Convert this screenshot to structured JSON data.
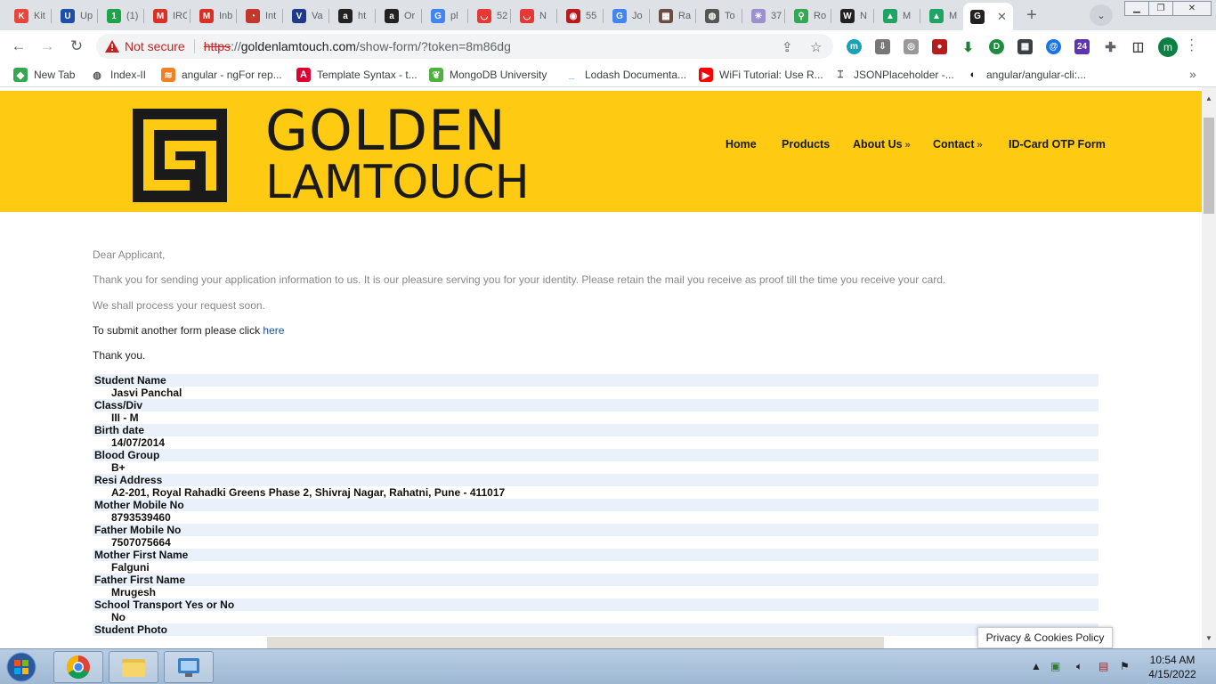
{
  "browser": {
    "tabs": [
      {
        "label": "Kit",
        "fav": "K",
        "color": "#e8453c"
      },
      {
        "label": "Up",
        "fav": "U",
        "color": "#1f4ea8"
      },
      {
        "label": "(1)",
        "fav": "1",
        "color": "#1ea446"
      },
      {
        "label": "IRC",
        "fav": "M",
        "color": "#d93025"
      },
      {
        "label": "Inb",
        "fav": "M",
        "color": "#d93025"
      },
      {
        "label": "Int",
        "fav": "◔",
        "color": "#c0392b"
      },
      {
        "label": "Va",
        "fav": "V",
        "color": "#1e3a8a"
      },
      {
        "label": "ht",
        "fav": "a",
        "color": "#222222"
      },
      {
        "label": "Or",
        "fav": "a",
        "color": "#222222"
      },
      {
        "label": "pl",
        "fav": "G",
        "color": "#4285f4"
      },
      {
        "label": "52",
        "fav": "◡",
        "color": "#e53935"
      },
      {
        "label": "N",
        "fav": "◡",
        "color": "#e53935"
      },
      {
        "label": "55",
        "fav": "◉",
        "color": "#b71c1c"
      },
      {
        "label": "Jo",
        "fav": "G",
        "color": "#4285f4"
      },
      {
        "label": "Ra",
        "fav": "▦",
        "color": "#6d4c41"
      },
      {
        "label": "To",
        "fav": "◍",
        "color": "#555555"
      },
      {
        "label": "37",
        "fav": "✳",
        "color": "#9c8fd0"
      },
      {
        "label": "Ro",
        "fav": "⚲",
        "color": "#34a853"
      },
      {
        "label": "N",
        "fav": "W",
        "color": "#222222"
      },
      {
        "label": "M",
        "fav": "▲",
        "color": "#1fa463"
      },
      {
        "label": "M",
        "fav": "▲",
        "color": "#1fa463"
      }
    ],
    "active_tab_close": "✕",
    "new_tab": "+",
    "omnibox": {
      "not_secure": "Not secure",
      "scheme": "https",
      "host_sep": "://",
      "host": "goldenlamtouch.com",
      "path": "/show-form/?token=8m86dg"
    },
    "profile_initial": "m",
    "bookmarks": [
      {
        "label": "New Tab",
        "icon": "leaf-icon"
      },
      {
        "label": "Index-II",
        "icon": "globe-icon"
      },
      {
        "label": "angular - ngFor rep...",
        "icon": "stackoverflow-icon"
      },
      {
        "label": "Template Syntax - t...",
        "icon": "angular-icon"
      },
      {
        "label": "MongoDB University",
        "icon": "mongodb-icon"
      },
      {
        "label": "Lodash Documenta...",
        "icon": "lodash-icon"
      },
      {
        "label": "WiFi Tutorial: Use R...",
        "icon": "youtube-icon"
      },
      {
        "label": "JSONPlaceholder -...",
        "icon": "jsonplaceholder-icon"
      },
      {
        "label": "angular/angular-cli:...",
        "icon": "github-icon"
      }
    ]
  },
  "site": {
    "logo_line1": "GOLDEN",
    "logo_line2": "LAMTOUCH",
    "nav": [
      {
        "label": "Home",
        "arrow": ""
      },
      {
        "label": "Products",
        "arrow": ""
      },
      {
        "label": "About Us",
        "arrow": "»"
      },
      {
        "label": "Contact",
        "arrow": "»"
      },
      {
        "label": "ID-Card OTP Form",
        "arrow": ""
      }
    ],
    "colors": {
      "brand_yellow": "#fecb12",
      "row_highlight": "#eaf1fb",
      "link": "#1a55a0"
    }
  },
  "message": {
    "greeting": "Dear Applicant,",
    "thanks": "Thank you for sending your application information to us. It is our pleasure serving you for your identity. Please retain the mail you receive as proof till the time you receive your card.",
    "process": "We shall process your request soon.",
    "another_prefix": "To submit another form please click ",
    "another_link": "here",
    "thank_you": "Thank you."
  },
  "record": [
    {
      "label": "Student Name",
      "value": "Jasvi Panchal"
    },
    {
      "label": "Class/Div",
      "value": "III - M"
    },
    {
      "label": "Birth date",
      "value": "14/07/2014"
    },
    {
      "label": "Blood Group",
      "value": "B+"
    },
    {
      "label": "Resi Address",
      "value": "A2-201, Royal Rahadki Greens Phase 2, Shivraj Nagar, Rahatni, Pune - 411017"
    },
    {
      "label": "Mother Mobile No",
      "value": "8793539460"
    },
    {
      "label": "Father Mobile No",
      "value": "7507075664"
    },
    {
      "label": "Mother First Name",
      "value": "Falguni"
    },
    {
      "label": "Father First Name",
      "value": "Mrugesh"
    },
    {
      "label": "School Transport Yes or No",
      "value": "No"
    },
    {
      "label": "Student Photo",
      "value": ""
    }
  ],
  "cookie_banner": "Privacy & Cookies Policy",
  "taskbar": {
    "time": "10:54 AM",
    "date": "4/15/2022"
  }
}
